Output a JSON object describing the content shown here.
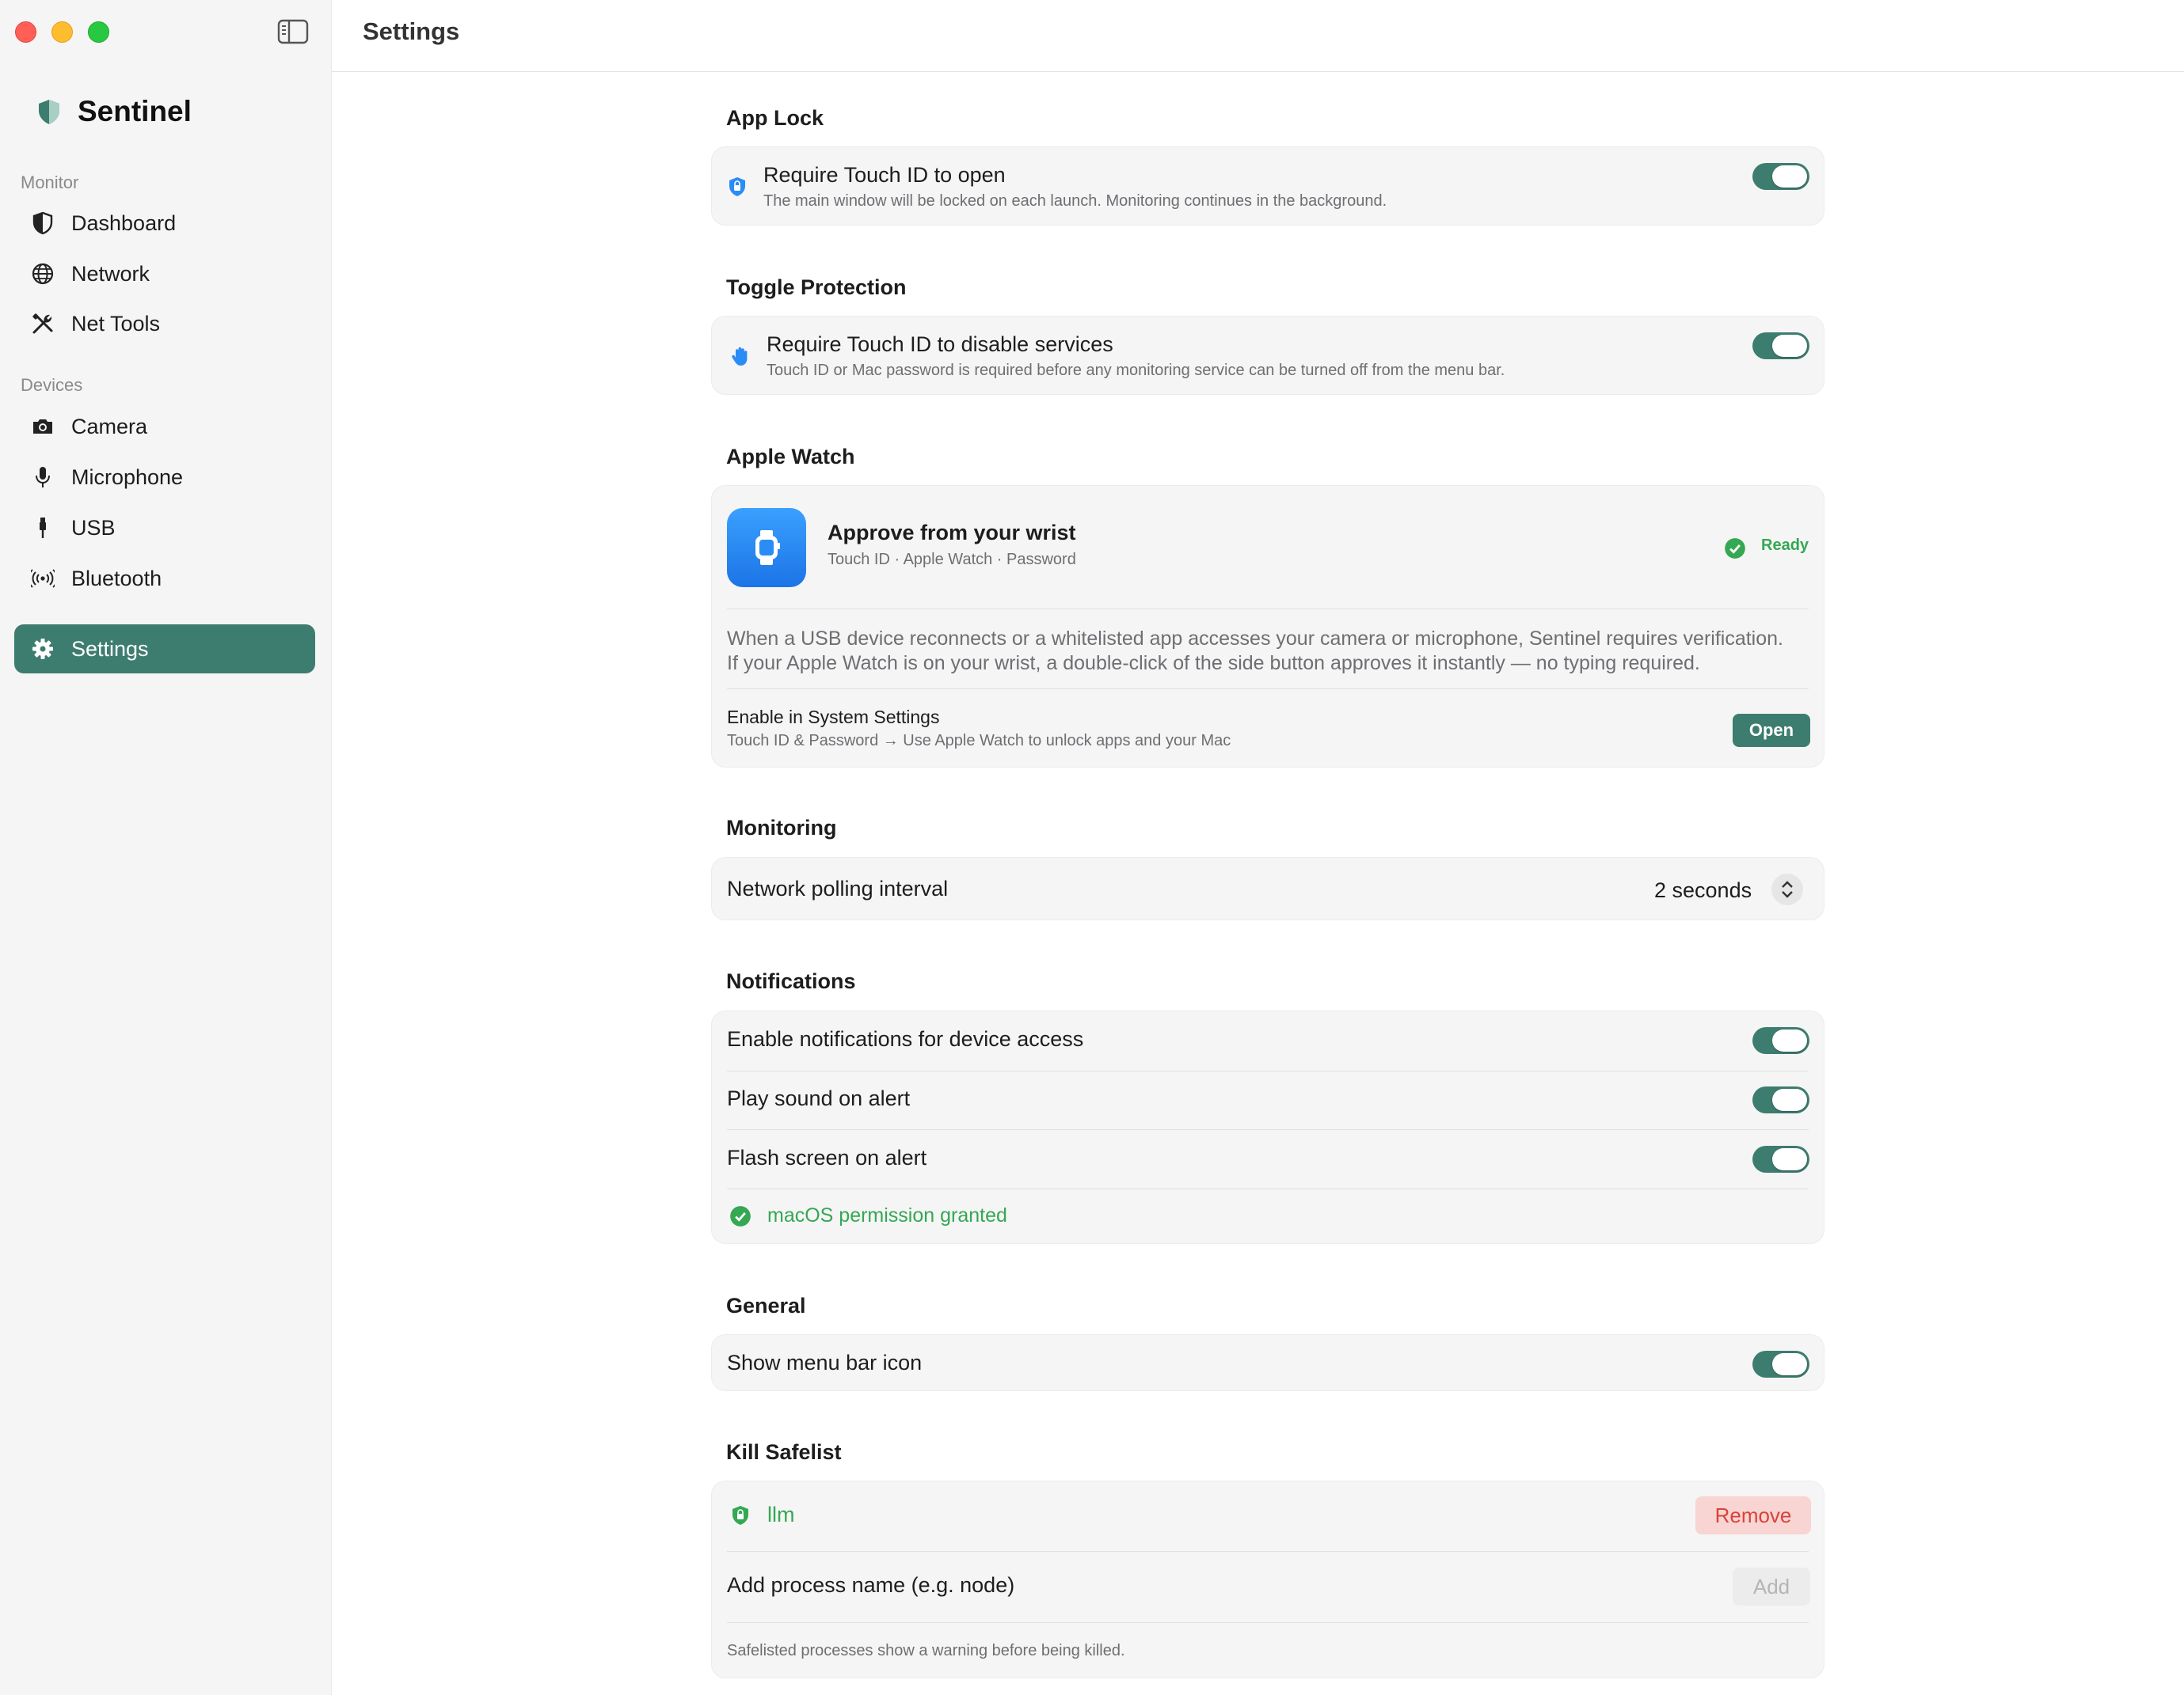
{
  "window": {
    "title": "Settings"
  },
  "sidebar": {
    "brand": "Sentinel",
    "sections": [
      {
        "label": "Monitor",
        "items": [
          "Dashboard",
          "Network",
          "Net Tools"
        ]
      },
      {
        "label": "Devices",
        "items": [
          "Camera",
          "Microphone",
          "USB",
          "Bluetooth"
        ]
      }
    ],
    "settings_label": "Settings"
  },
  "app_lock": {
    "title": "App Lock",
    "row_title": "Require Touch ID to open",
    "row_sub": "The main window will be locked on each launch. Monitoring continues in the background.",
    "enabled": true
  },
  "toggle_protection": {
    "title": "Toggle Protection",
    "row_title": "Require Touch ID to disable services",
    "row_sub": "Touch ID or Mac password is required before any monitoring service can be turned off from the menu bar.",
    "enabled": true
  },
  "apple_watch": {
    "title": "Apple Watch",
    "heading": "Approve from your wrist",
    "methods": "Touch ID · Apple Watch · Password",
    "status": "Ready",
    "description_line1": "When a USB device reconnects or a whitelisted app accesses your camera or microphone, Sentinel requires verification.",
    "description_line2": "If your Apple Watch is on your wrist, a double-click of the side button approves it instantly — no typing required.",
    "enable_title": "Enable in System Settings",
    "enable_path": "Touch ID & Password → Use Apple Watch to unlock apps and your Mac",
    "open_label": "Open"
  },
  "monitoring": {
    "title": "Monitoring",
    "interval_label": "Network polling interval",
    "interval_value": "2 seconds"
  },
  "notifications": {
    "title": "Notifications",
    "rows": [
      {
        "label": "Enable notifications for device access",
        "enabled": true
      },
      {
        "label": "Play sound on alert",
        "enabled": true
      },
      {
        "label": "Flash screen on alert",
        "enabled": true
      }
    ],
    "permission": "macOS permission granted"
  },
  "general": {
    "title": "General",
    "menu_bar_label": "Show menu bar icon",
    "enabled": true
  },
  "kill_safelist": {
    "title": "Kill Safelist",
    "items": [
      "llm"
    ],
    "remove_label": "Remove",
    "add_placeholder": "Add process name (e.g. node)",
    "add_label": "Add",
    "footer": "Safelisted processes show a warning before being killed."
  },
  "colors": {
    "accent": "#3d7d6f",
    "success": "#34a853",
    "danger": "#d9433b",
    "watch_blue": "#2a8cf5"
  },
  "icons": [
    "shield-icon",
    "globe-icon",
    "tools-icon",
    "camera-icon",
    "microphone-icon",
    "usb-icon",
    "bluetooth-icon",
    "gear-icon",
    "lock-shield-icon",
    "hand-icon",
    "watch-icon",
    "checkmark-circle-icon",
    "stepper-icon"
  ]
}
